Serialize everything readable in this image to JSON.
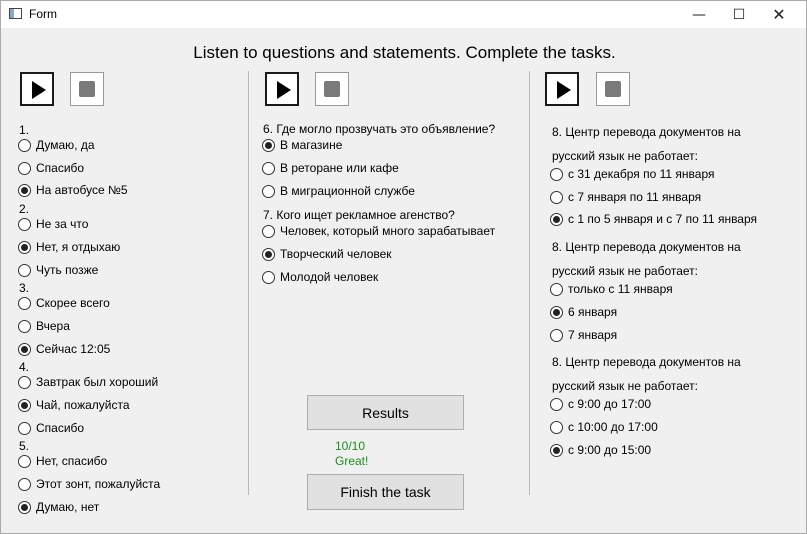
{
  "window": {
    "title": "Form",
    "minimize": "—",
    "maximize": "☐",
    "close": "✕"
  },
  "heading": "Listen to questions and statements. Complete the tasks.",
  "columns": [
    {
      "labels": [
        {
          "text": "1."
        },
        {
          "text": "2."
        },
        {
          "text": "3."
        },
        {
          "text": "4."
        },
        {
          "text": "5."
        }
      ],
      "options": [
        {
          "label": "Думаю, да",
          "checked": false
        },
        {
          "label": "Спасибо",
          "checked": false
        },
        {
          "label": "На автобусе №5",
          "checked": true
        },
        {
          "label": "Не за что",
          "checked": false
        },
        {
          "label": "Нет, я отдыхаю",
          "checked": true
        },
        {
          "label": "Чуть позже",
          "checked": false
        },
        {
          "label": "Скорее всего",
          "checked": false
        },
        {
          "label": "Вчера",
          "checked": false
        },
        {
          "label": "Сейчас 12:05",
          "checked": true
        },
        {
          "label": "Завтрак был хороший",
          "checked": false
        },
        {
          "label": "Чай, пожалуйста",
          "checked": true
        },
        {
          "label": "Спасибо",
          "checked": false
        },
        {
          "label": "Нет, спасибо",
          "checked": false
        },
        {
          "label": "Этот зонт, пожалуйста",
          "checked": false
        },
        {
          "label": "Думаю, нет",
          "checked": true
        }
      ]
    },
    {
      "labels": [
        {
          "text": "6. Где могло прозвучать это объявление?"
        },
        {
          "text": "7. Кого ищет рекламное агенство?"
        }
      ],
      "options": [
        {
          "label": "В магазине",
          "checked": true
        },
        {
          "label": "В реторане или кафе",
          "checked": false
        },
        {
          "label": "В миграционной службе",
          "checked": false
        },
        {
          "label": "Человек, который много зарабатывает",
          "checked": false
        },
        {
          "label": "Творческий человек",
          "checked": true
        },
        {
          "label": "Молодой человек",
          "checked": false
        }
      ]
    },
    {
      "labels": [
        {
          "text": "8. Центр перевода документов на"
        },
        {
          "text": "русский язык не работает:"
        },
        {
          "text": "8. Центр перевода документов на"
        },
        {
          "text": "русский язык не работает:"
        },
        {
          "text": "8. Центр перевода документов на"
        },
        {
          "text": "русский язык не работает:"
        }
      ],
      "options": [
        {
          "label": "с 31 декабря по 11 января",
          "checked": false
        },
        {
          "label": "с 7 января по 11 января",
          "checked": false
        },
        {
          "label": "с 1 по 5 января и с 7 по 11 января",
          "checked": true
        },
        {
          "label": "только с 11 января",
          "checked": false
        },
        {
          "label": "6 января",
          "checked": true
        },
        {
          "label": "7 января",
          "checked": false
        },
        {
          "label": "с 9:00 до 17:00",
          "checked": false
        },
        {
          "label": "с 10:00 до 17:00",
          "checked": false
        },
        {
          "label": "с 9:00 до 15:00",
          "checked": true
        }
      ]
    }
  ],
  "results_button": "Results",
  "score": "10/10",
  "feedback": "Great!",
  "finish_button": "Finish the task",
  "colors": {
    "feedback": "#1e8c1e",
    "background": "#f0f0f0"
  }
}
